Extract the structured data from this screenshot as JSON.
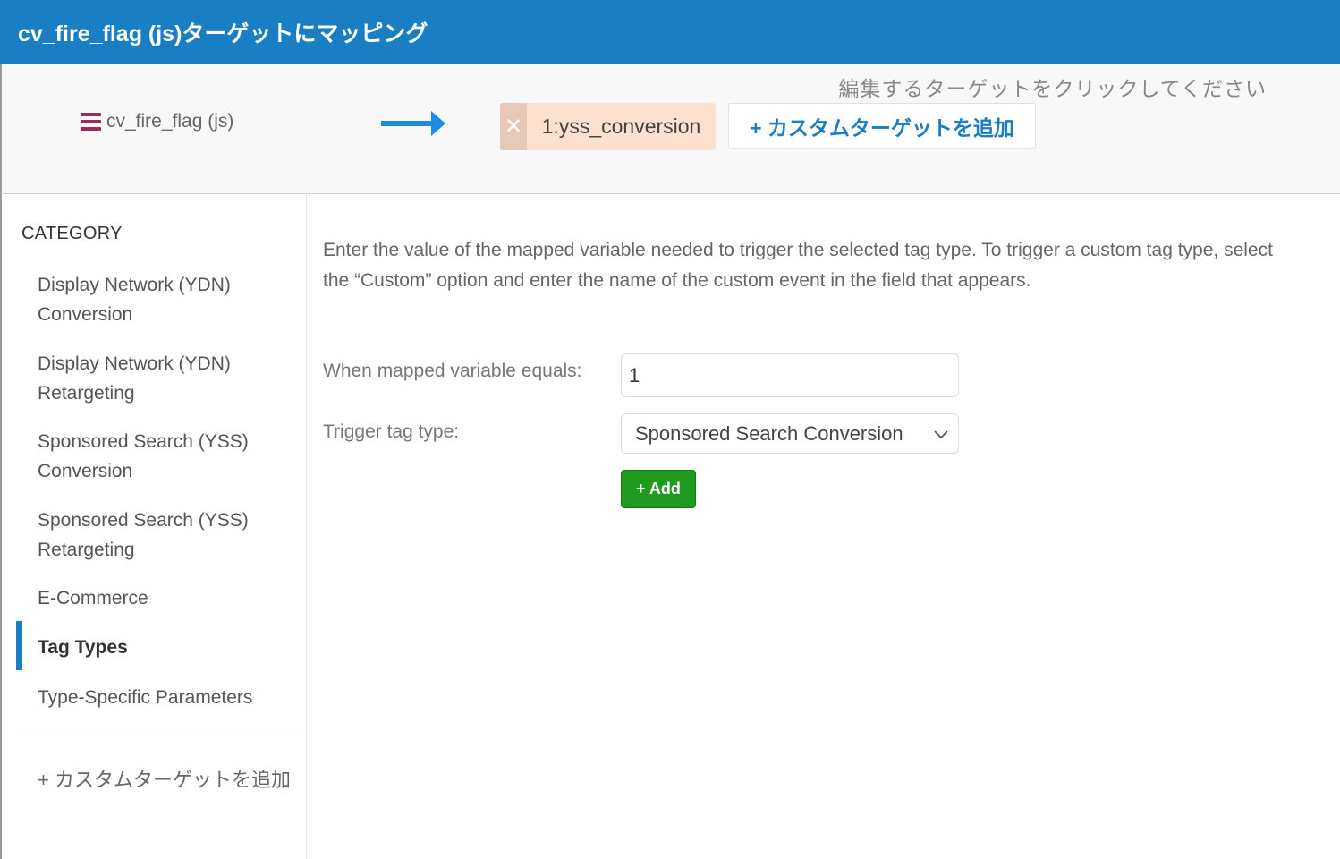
{
  "window": {
    "title": "cv_fire_flag (js)ターゲットにマッピング"
  },
  "mapping": {
    "hint": "編集するターゲットをクリックしてください",
    "source_variable": "cv_fire_flag (js)",
    "target_chip": {
      "remove_glyph": "✕",
      "label": "1:yss_conversion"
    },
    "add_custom_target": "+ カスタムターゲットを追加"
  },
  "sidebar": {
    "heading": "CATEGORY",
    "items": [
      {
        "label": "Display Network (YDN) Conversion",
        "active": false
      },
      {
        "label": "Display Network (YDN) Retargeting",
        "active": false
      },
      {
        "label": "Sponsored Search (YSS) Conversion",
        "active": false
      },
      {
        "label": "Sponsored Search (YSS) Retargeting",
        "active": false
      },
      {
        "label": "E-Commerce",
        "active": false
      },
      {
        "label": "Tag Types",
        "active": true
      },
      {
        "label": "Type-Specific Parameters",
        "active": false
      }
    ],
    "add_custom_target": "+ カスタムターゲットを追加"
  },
  "main": {
    "description": "Enter the value of the mapped variable needed to trigger the selected tag type. To trigger a custom tag type, select the “Custom” option and enter the name of the custom event in the field that appears.",
    "value_label": "When mapped variable equals:",
    "value": "1",
    "trigger_label": "Trigger tag type:",
    "trigger_selected": "Sponsored Search Conversion",
    "add_button": "+ Add"
  },
  "colors": {
    "header_blue": "#1a7ec4",
    "chip_bg": "#fce0d0",
    "add_green": "#1e9a1e",
    "hamburger": "#9b2c5a",
    "arrow": "#1a8de0"
  }
}
